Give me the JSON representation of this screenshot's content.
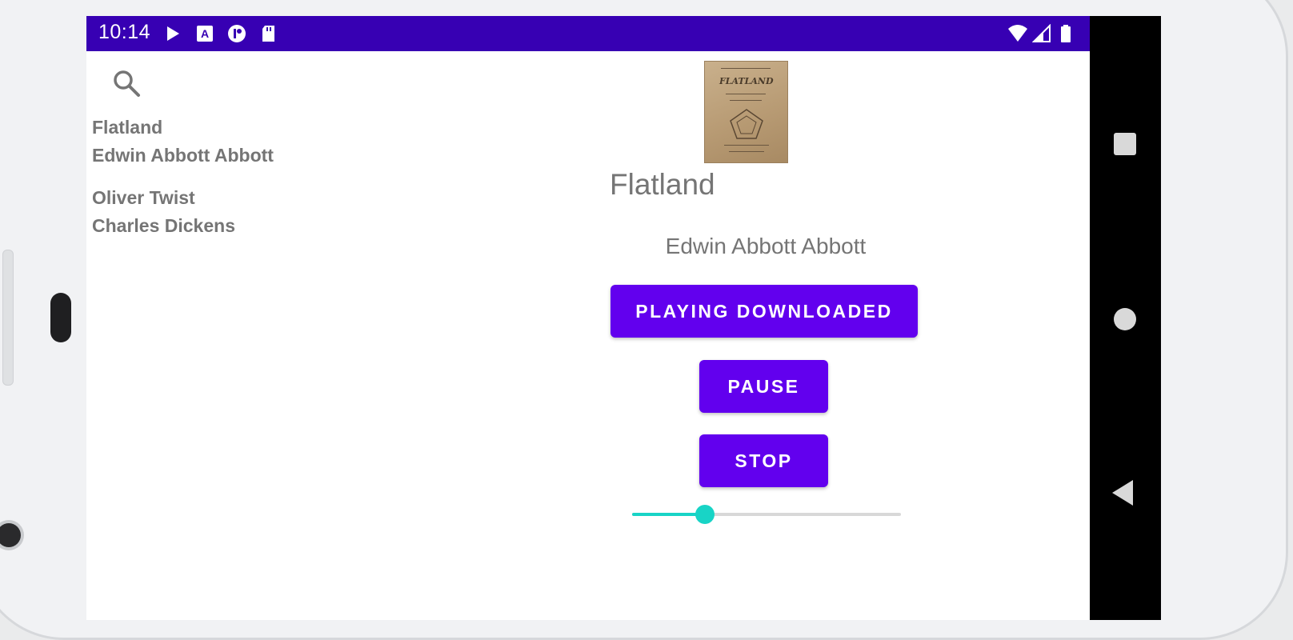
{
  "status_bar": {
    "time": "10:14",
    "icons": [
      "play-icon",
      "a-icon",
      "circle-app-icon",
      "sd-card-icon",
      "wifi-icon",
      "signal-icon",
      "battery-icon"
    ]
  },
  "search": {
    "icon": "search-icon"
  },
  "book_list": [
    {
      "title": "Flatland",
      "author": "Edwin Abbott Abbott"
    },
    {
      "title": "Oliver Twist",
      "author": "Charles Dickens"
    }
  ],
  "detail": {
    "title": "Flatland",
    "author": "Edwin Abbott Abbott",
    "cover_icon": "book-cover-image",
    "cover_title": "FLATLAND"
  },
  "controls": {
    "playing_label": "PLAYING DOWNLOADED",
    "pause_label": "PAUSE",
    "stop_label": "STOP"
  },
  "seekbar": {
    "progress": 0.27
  },
  "nav_bar": {
    "icons": [
      "recents-icon",
      "home-icon",
      "back-icon"
    ]
  },
  "colors": {
    "status_bar": "#3700b3",
    "button": "#6200ee",
    "seek_accent": "#18d4c6",
    "text_gray": "#757575"
  }
}
